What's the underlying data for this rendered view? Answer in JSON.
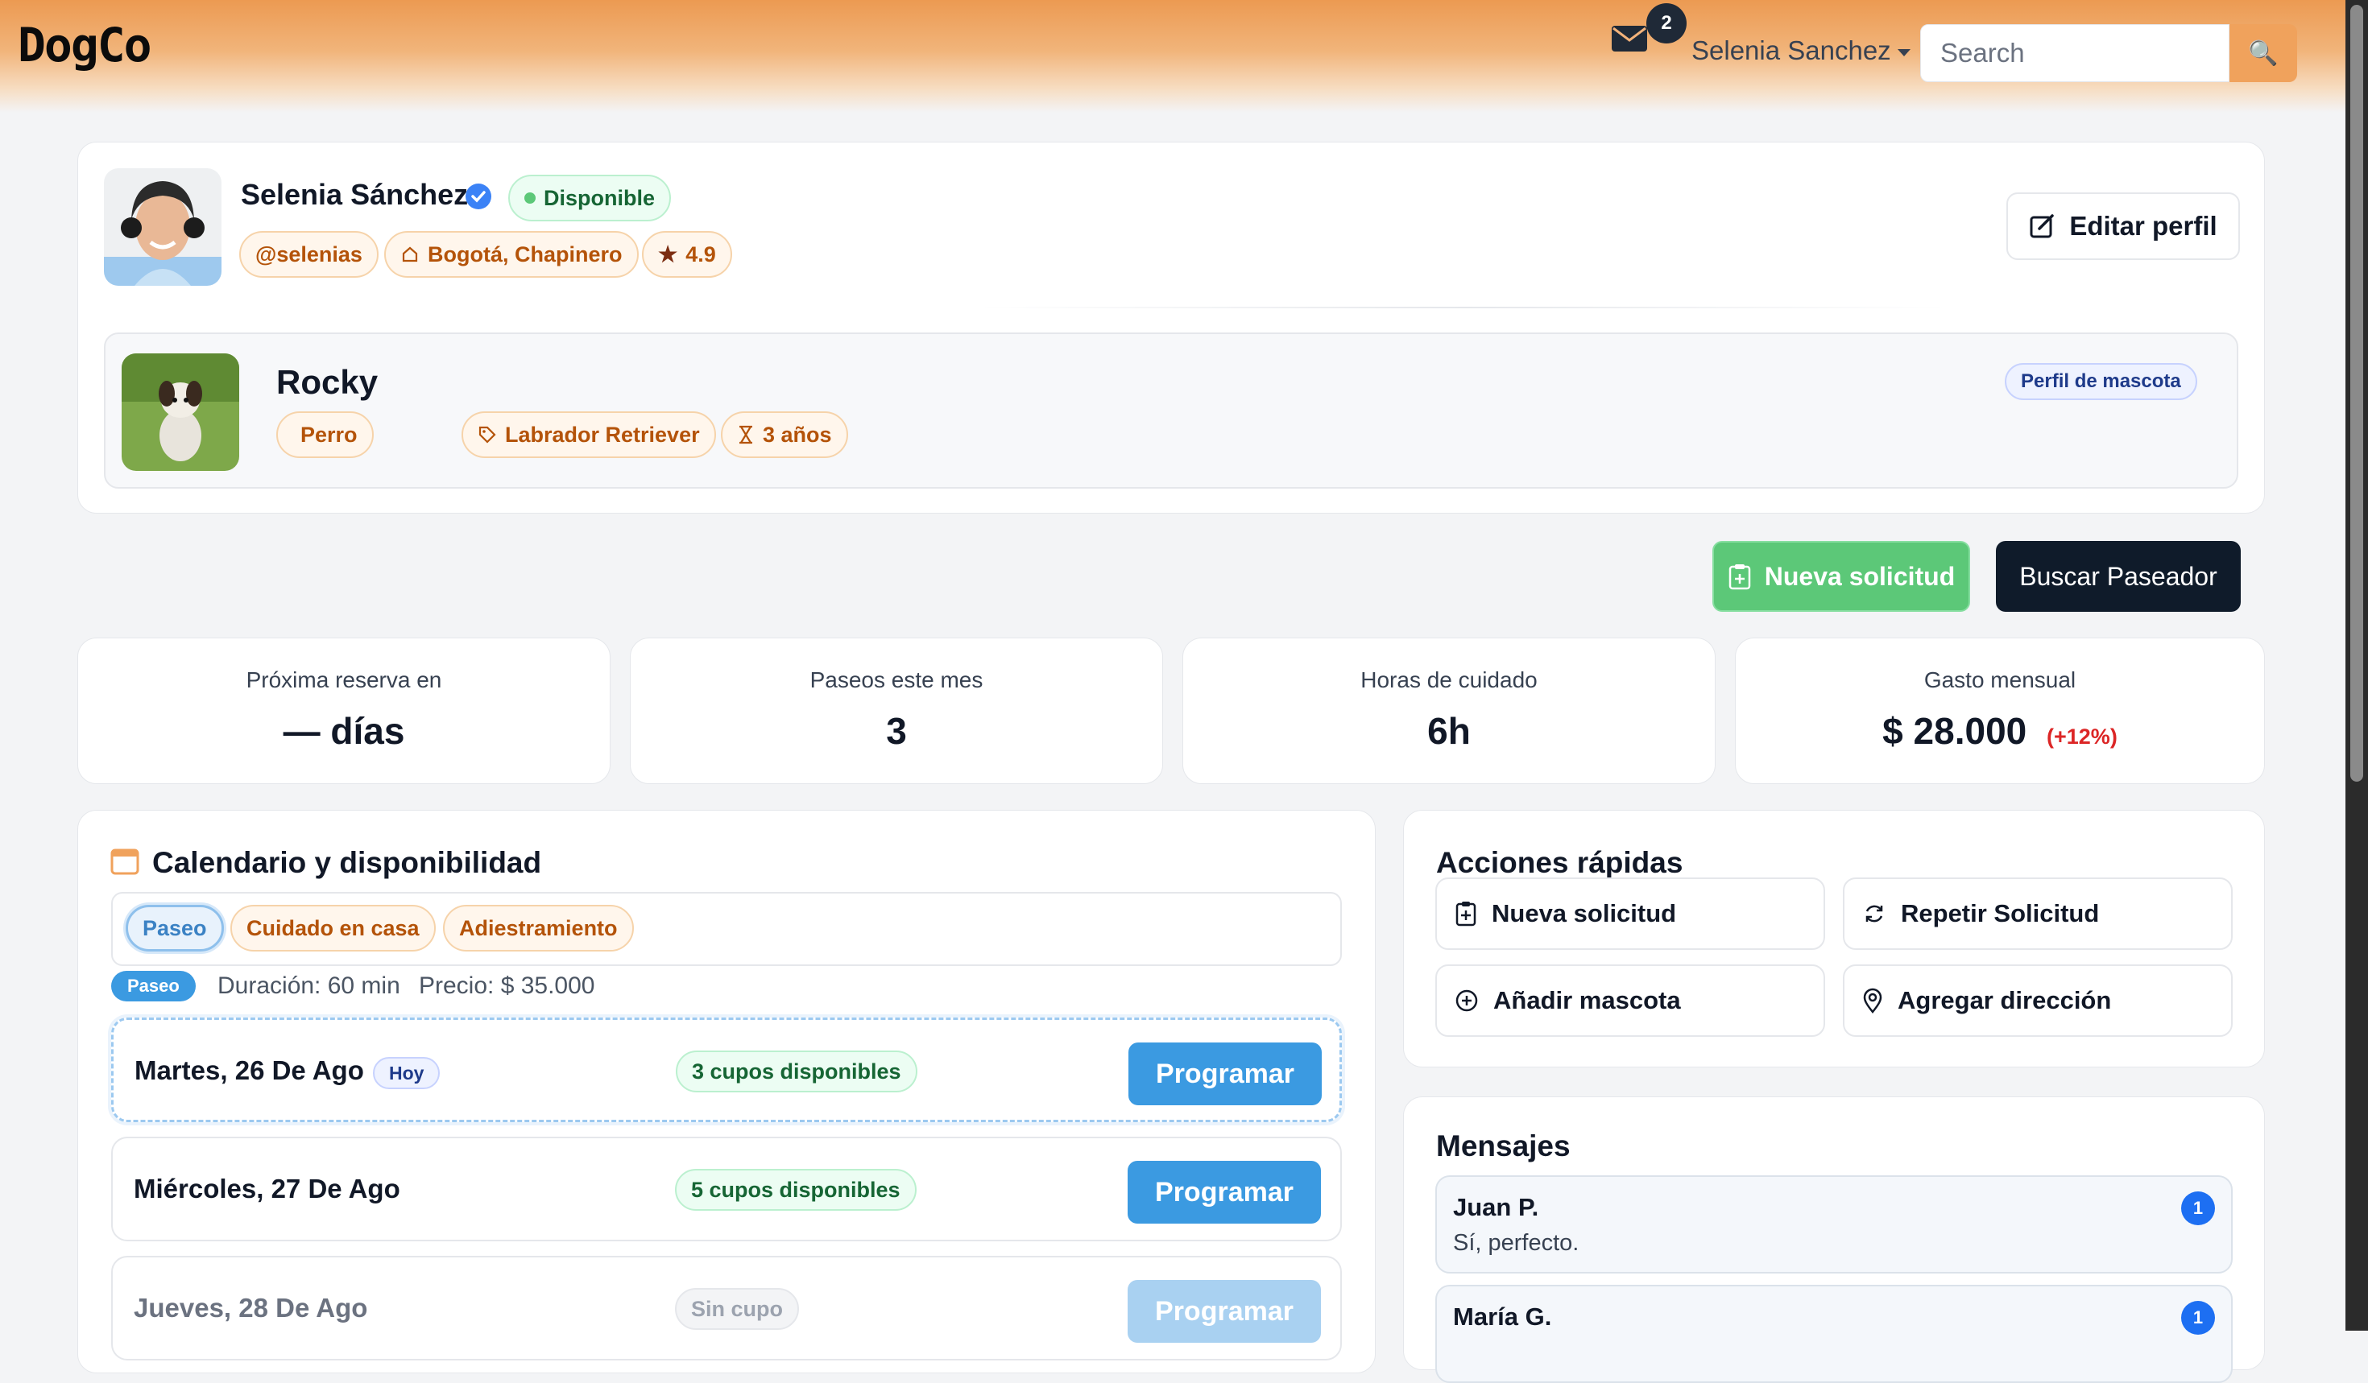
{
  "nav": {
    "logo": "DogCo",
    "mail_count": "2",
    "user_name": "Selenia Sanchez",
    "search_placeholder": "Search"
  },
  "profile": {
    "name": "Selenia Sánchez",
    "status": "Disponible",
    "username": "@selenias",
    "location": "Bogotá, Chapinero",
    "rating": "4.9",
    "edit_label": "Editar perfil"
  },
  "pet": {
    "name": "Rocky",
    "species": "Perro",
    "breed": "Labrador Retriever",
    "age": "3 años",
    "profile_tag": "Perfil de mascota"
  },
  "actions": {
    "new_request": "Nueva solicitud",
    "find_walker": "Buscar Paseador"
  },
  "stats": [
    {
      "label": "Próxima reserva en",
      "value": "— días"
    },
    {
      "label": "Paseos este mes",
      "value": "3"
    },
    {
      "label": "Horas de cuidado",
      "value": "6h"
    },
    {
      "label": "Gasto mensual",
      "value": "$ 28.000",
      "delta": "(+12%)"
    }
  ],
  "calendar": {
    "title": "Calendario y disponibilidad",
    "tabs": [
      "Paseo",
      "Cuidado en casa",
      "Adiestramiento"
    ],
    "active_tab": "Paseo",
    "service_tag": "Paseo",
    "duration": "Duración: 60 min",
    "price": "Precio: $ 35.000",
    "days": [
      {
        "date": "Martes, 26 De Ago",
        "today": "Hoy",
        "slots": "3 cupos disponibles",
        "button": "Programar"
      },
      {
        "date": "Miércoles, 27 De Ago",
        "slots": "5 cupos disponibles",
        "button": "Programar"
      },
      {
        "date": "Jueves, 28 De Ago",
        "slots": "Sin cupo",
        "button": "Programar"
      }
    ]
  },
  "quick_actions": {
    "title": "Acciones rápidas",
    "items": [
      "Nueva solicitud",
      "Repetir Solicitud",
      "Añadir mascota",
      "Agregar dirección"
    ]
  },
  "messages": {
    "title": "Mensajes",
    "items": [
      {
        "name": "Juan P.",
        "text": "Sí, perfecto.",
        "unread": "1"
      },
      {
        "name": "María G.",
        "text": "",
        "unread": "1"
      }
    ]
  },
  "colors": {
    "brand_orange": "#f0a25c",
    "success_green": "#5cc878",
    "primary_blue": "#3b9ae1",
    "dark": "#0f1b2a"
  }
}
